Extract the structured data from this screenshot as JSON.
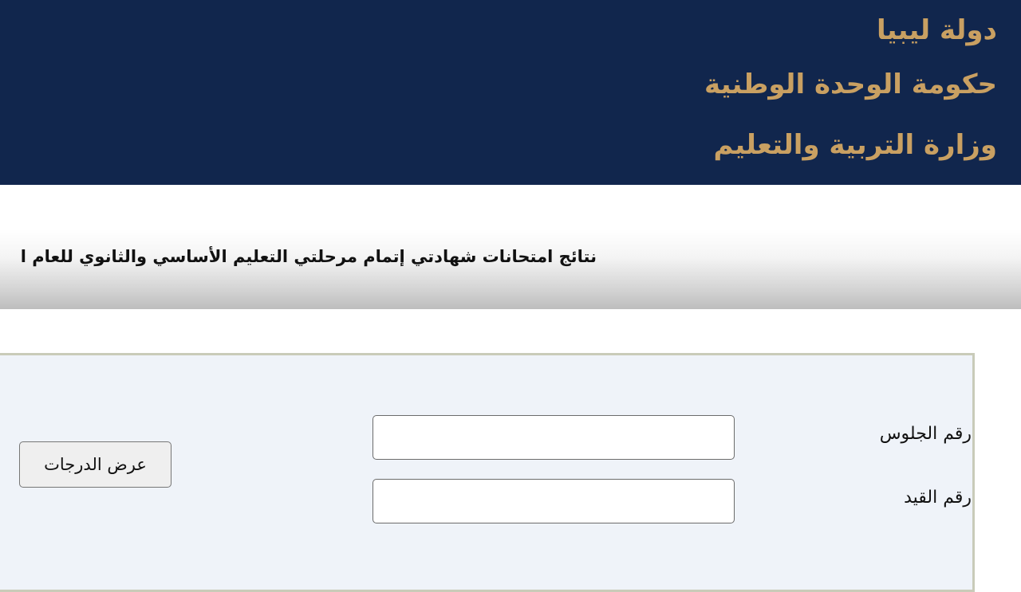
{
  "header": {
    "line1": "دولة ليبيا",
    "line2": "حكومة الوحدة الوطنية",
    "line3": "وزارة التربية والتعليم",
    "background_color": "#11264d",
    "text_color": "#c9a062"
  },
  "title": {
    "text": "نتائج امتحانات شهادتي إتمام مرحلتي التعليم الأساسي والثانوي للعام ا"
  },
  "form": {
    "seat_number_label": "رقم الجلوس",
    "seat_number_value": "",
    "registration_number_label": "رقم القيد",
    "registration_number_value": "",
    "submit_label": "عرض الدرجات",
    "panel_color": "#eff3f9"
  }
}
